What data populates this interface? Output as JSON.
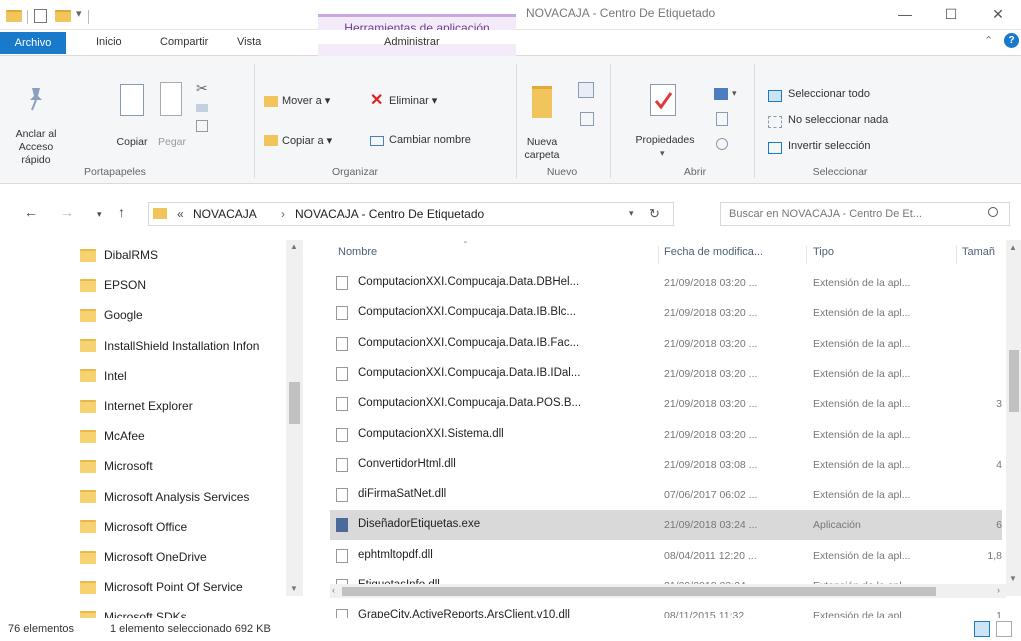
{
  "window": {
    "title": "NOVACAJA - Centro De Etiquetado",
    "context_tab": "Herramientas de aplicación",
    "minimize": "—",
    "maximize": "☐",
    "close": "✕"
  },
  "tabs": {
    "file": "Archivo",
    "home": "Inicio",
    "share": "Compartir",
    "view": "Vista",
    "manage": "Administrar"
  },
  "ribbon": {
    "pin_label": "Anclar al Acceso rápido",
    "copy_label": "Copiar",
    "paste_label": "Pegar",
    "group_clipboard": "Portapapeles",
    "move_to": "Mover a ▾",
    "copy_to": "Copiar a ▾",
    "delete": "Eliminar ▾",
    "rename": "Cambiar nombre",
    "group_organize": "Organizar",
    "new_folder": "Nueva carpeta",
    "group_new": "Nuevo",
    "properties": "Propiedades",
    "group_open": "Abrir",
    "select_all": "Seleccionar todo",
    "select_none": "No seleccionar nada",
    "invert_selection": "Invertir selección",
    "group_select": "Seleccionar"
  },
  "address": {
    "crumb_prefix": "«",
    "crumb_1": "NOVACAJA",
    "crumb_sep": "›",
    "crumb_2": "NOVACAJA - Centro De Etiquetado",
    "search_placeholder": "Buscar en NOVACAJA - Centro De Et..."
  },
  "tree": [
    "DibalRMS",
    "EPSON",
    "Google",
    "InstallShield Installation Infon",
    "Intel",
    "Internet Explorer",
    "McAfee",
    "Microsoft",
    "Microsoft Analysis Services",
    "Microsoft Office",
    "Microsoft OneDrive",
    "Microsoft Point Of Service",
    "Microsoft SDKs"
  ],
  "columns": {
    "name": "Nombre",
    "date": "Fecha de modifica...",
    "type": "Tipo",
    "size": "Tamañ"
  },
  "files": [
    {
      "name": "ComputacionXXI.Compucaja.Data.DBHel...",
      "date": "21/09/2018 03:20 ...",
      "type": "Extensión de la apl...",
      "size": ""
    },
    {
      "name": "ComputacionXXI.Compucaja.Data.IB.Blc...",
      "date": "21/09/2018 03:20 ...",
      "type": "Extensión de la apl...",
      "size": ""
    },
    {
      "name": "ComputacionXXI.Compucaja.Data.IB.Fac...",
      "date": "21/09/2018 03:20 ...",
      "type": "Extensión de la apl...",
      "size": ""
    },
    {
      "name": "ComputacionXXI.Compucaja.Data.IB.IDal...",
      "date": "21/09/2018 03:20 ...",
      "type": "Extensión de la apl...",
      "size": ""
    },
    {
      "name": "ComputacionXXI.Compucaja.Data.POS.B...",
      "date": "21/09/2018 03:20 ...",
      "type": "Extensión de la apl...",
      "size": "3"
    },
    {
      "name": "ComputacionXXI.Sistema.dll",
      "date": "21/09/2018 03:20 ...",
      "type": "Extensión de la apl...",
      "size": ""
    },
    {
      "name": "ConvertidorHtml.dll",
      "date": "21/09/2018 03:08 ...",
      "type": "Extensión de la apl...",
      "size": "4"
    },
    {
      "name": "diFirmaSatNet.dll",
      "date": "07/06/2017 06:02 ...",
      "type": "Extensión de la apl...",
      "size": ""
    },
    {
      "name": "DiseñadorEtiquetas.exe",
      "date": "21/09/2018 03:24 ...",
      "type": "Aplicación",
      "size": "6"
    },
    {
      "name": "ephtmltopdf.dll",
      "date": "08/04/2011 12:20 ...",
      "type": "Extensión de la apl...",
      "size": "1,8"
    },
    {
      "name": "EtiquetasInfo.dll",
      "date": "21/09/2018 03:24 ...",
      "type": "Extensión de la apl...",
      "size": ""
    },
    {
      "name": "GrapeCity.ActiveReports.ArsClient.v10.dll",
      "date": "08/11/2015 11:32 ...",
      "type": "Extensión de la apl...",
      "size": "1"
    }
  ],
  "status": {
    "count": "76 elementos",
    "selection": "1 elemento seleccionado  692 KB"
  },
  "colors": {
    "accent": "#1979ca",
    "selected_row": "#d9d9d9",
    "context_tab": "#f3ecf8",
    "folder": "#f6d271"
  }
}
